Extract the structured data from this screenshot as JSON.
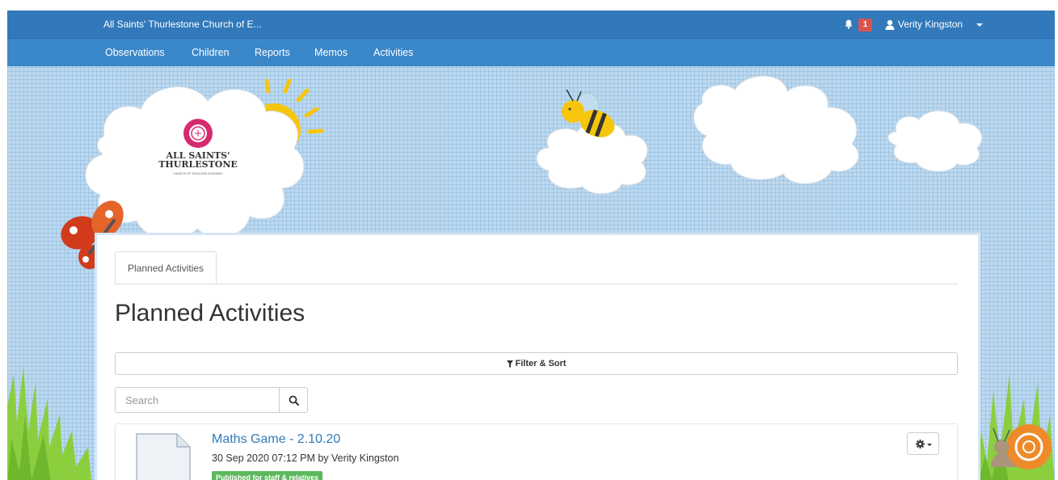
{
  "navbar": {
    "brand": "All Saints' Thurlestone Church of E...",
    "notification_count": "1",
    "user_name": "Verity Kingston",
    "items": [
      "Observations",
      "Children",
      "Reports",
      "Memos",
      "Activities"
    ]
  },
  "banner": {
    "school_name_line1": "ALL SAINTS'",
    "school_name_line2": "THURLESTONE",
    "school_subtitle": "CHURCH OF ENGLAND ACADEMY"
  },
  "tabs": [
    {
      "label": "Planned Activities",
      "active": true
    }
  ],
  "page": {
    "title": "Planned Activities",
    "filter_label": "Filter & Sort",
    "search_placeholder": "Search"
  },
  "activities": [
    {
      "title": "Maths Game - 2.10.20",
      "meta": "30 Sep 2020 07:12 PM by Verity Kingston",
      "status": "Published for staff & relatives"
    }
  ],
  "colors": {
    "navbar_top": "#3179bb",
    "navbar_bottom": "#3a87c9",
    "link": "#337ab7",
    "status_green": "#5cb85c",
    "badge_red": "#d9534f"
  }
}
